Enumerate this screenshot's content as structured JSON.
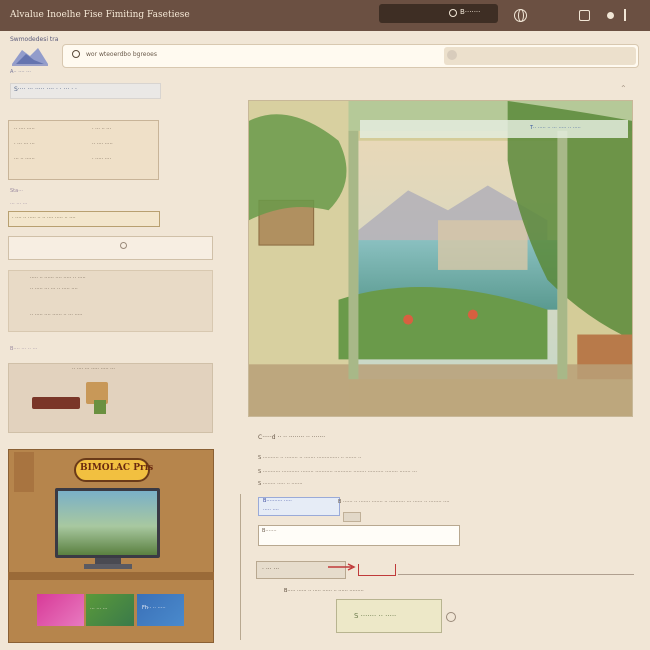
{
  "app": {
    "title": "Alvalue Inoelhe Fise Fimiting Fasetiese"
  },
  "topbar": {
    "pill_label": "B·······"
  },
  "brand": {
    "caption": "Swmodedesi tra",
    "sub": "A·· ···· ···"
  },
  "search": {
    "text": "wor wteoerdbo bgreoes"
  },
  "info_strip": {
    "text": "S···· ··· ····· ···· · · ··· · ·"
  },
  "card_a": {
    "left": [
      "·· ···· ·····",
      "· ··· ··· ···",
      "··· ·· ······"
    ],
    "right": [
      "· ··· ·· ···",
      "·· ···· ·····",
      "· ····· ····"
    ]
  },
  "section1": {
    "head": "Sta···",
    "sub": "··· ··· ···"
  },
  "tag_row": {
    "text": "· ···· ·· ····· ·· ·· ···· ····· ·· ····"
  },
  "panel_b": {
    "lines": [
      "····· ·· ······ ···· ····· ·· ·····",
      "·· ····· ··· ··· ·· ····· ····",
      "·· ····· ···· ······ ·· ··· ·····"
    ]
  },
  "section2": {
    "head": "B···· ··· ·· ···"
  },
  "panel_c": {
    "text": "·· ···· ··· ····· ····· ···"
  },
  "game": {
    "logo": "BIMOLAC Pris",
    "cart2": "··· ··· ···",
    "cart3": "Fh·· ·· ·····"
  },
  "hero": {
    "banner": "T·· ····· ·· ··· ····· ·· ·····"
  },
  "content": {
    "para1": "C·····d ·· ·· ········ ·· ·······",
    "para2": "S ·········· ·· ········ ·· ······· ·············· ·· ······· ··",
    "para3": "S ··········· ··········· ········ ··········· ··········· ········ ·········· ········ ······· ···",
    "para4": "S ········ ····· ·· ·······"
  },
  "form": {
    "tab_line1": "B·········· ·····",
    "tab_line2": "····· ····",
    "caption": "B ······ ·· ······· ······· ·· ·········· ··· ······ ·· ········ ····",
    "input_value": "B·······",
    "select_value": "· ··· ···",
    "notice": "B····· ······ ·· ····· ······ ·· ······ ·········",
    "submit_label": "S ······· ·· ·····"
  },
  "colors": {
    "topbar": "#6b5042",
    "background": "#f1e6d6",
    "accent_red": "#c03a3a",
    "hero_green": "#6a9a4a"
  },
  "icons": [
    "globe-icon",
    "bag-icon",
    "search-icon",
    "help-icon",
    "chevron-icon"
  ]
}
